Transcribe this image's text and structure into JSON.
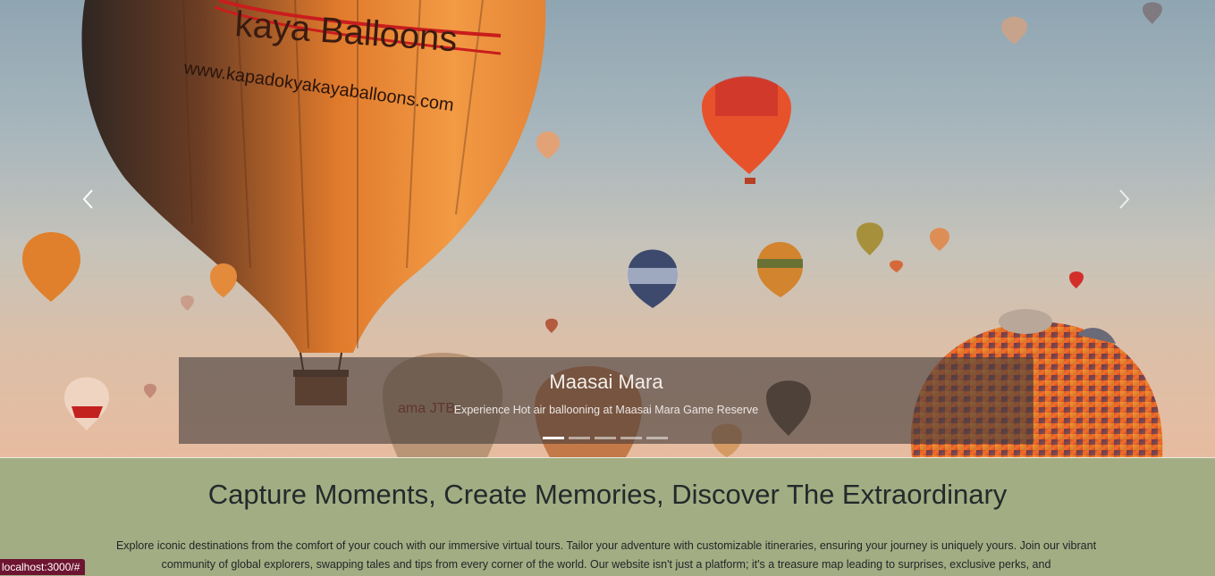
{
  "carousel": {
    "slide_title": "Maasai Mara",
    "slide_subtitle": "Experience Hot air ballooning at Maasai Mara Game Reserve",
    "balloon_banner_text": "kaya Balloons",
    "balloon_url_text": "www.kapadokyakayaballoons.com",
    "indicator_count": 5,
    "active_index": 0,
    "prev_icon": "chevron-left-icon",
    "next_icon": "chevron-right-icon"
  },
  "section": {
    "headline": "Capture Moments, Create Memories, Discover The Extraordinary",
    "paragraph": "Explore iconic destinations from the comfort of your couch with our immersive virtual tours. Tailor your adventure with customizable itineraries, ensuring your journey is uniquely yours. Join our vibrant community of global explorers, swapping tales and tips from every corner of the world. Our website isn't just a platform; it's a treasure map leading to surprises, exclusive perks, and"
  },
  "status_bar": {
    "url": "localhost:3000/#"
  },
  "colors": {
    "section_bg": "#a3ad83",
    "caption_bg": "rgba(70,62,60,0.62)",
    "status_bg": "#6d1431"
  }
}
